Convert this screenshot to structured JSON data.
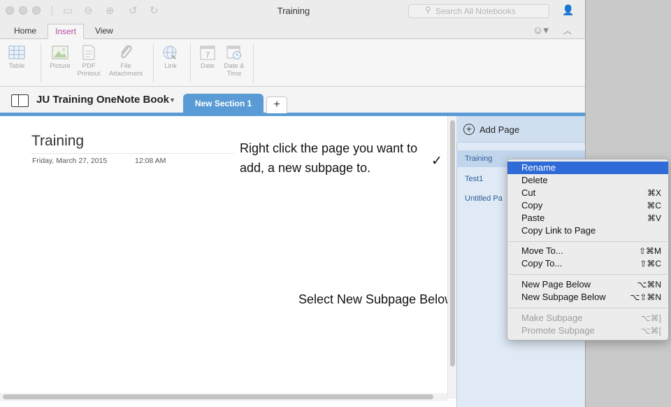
{
  "window": {
    "title": "Training"
  },
  "search": {
    "placeholder": "Search All Notebooks"
  },
  "ribbon_tabs": [
    {
      "label": "Home"
    },
    {
      "label": "Insert"
    },
    {
      "label": "View"
    }
  ],
  "ribbon": {
    "table": "Table",
    "picture": "Picture",
    "pdf": [
      "PDF",
      "Printout"
    ],
    "file": [
      "File",
      "Attachment"
    ],
    "link": "Link",
    "date": "Date",
    "datetime": [
      "Date &",
      "Time"
    ],
    "date_icon_number": "7"
  },
  "notebook": {
    "name": "JU Training OneNote Book"
  },
  "sections": [
    {
      "label": "New Section 1"
    }
  ],
  "add_section": "+",
  "page": {
    "title": "Training",
    "date": "Friday, March 27, 2015",
    "time": "12:08 AM"
  },
  "annotations": {
    "text1": "Right click the page you want to add, a new subpage to.",
    "check": "✓",
    "text2": "Select New Subpage Below.",
    "arrow": "〉"
  },
  "pages_panel": {
    "add_page_label": "Add Page",
    "items": [
      "Training",
      "Test1",
      "Untitled Pa"
    ]
  },
  "context_menu": {
    "rename": {
      "label": "Rename"
    },
    "delete": {
      "label": "Delete"
    },
    "cut": {
      "label": "Cut",
      "shortcut": "⌘X"
    },
    "copy": {
      "label": "Copy",
      "shortcut": "⌘C"
    },
    "paste": {
      "label": "Paste",
      "shortcut": "⌘V"
    },
    "copy_link": {
      "label": "Copy Link to Page"
    },
    "move_to": {
      "label": "Move To...",
      "shortcut": "⇧⌘M"
    },
    "copy_to": {
      "label": "Copy To...",
      "shortcut": "⇧⌘C"
    },
    "new_page_below": {
      "label": "New Page Below",
      "shortcut": "⌥⌘N"
    },
    "new_subpage_below": {
      "label": "New Subpage Below",
      "shortcut": "⌥⇧⌘N"
    },
    "make_subpage": {
      "label": "Make Subpage",
      "shortcut": "⌥⌘]"
    },
    "promote_subpage": {
      "label": "Promote Subpage",
      "shortcut": "⌥⌘["
    }
  },
  "colors": {
    "accent": "#5b9bd5",
    "menu_highlight": "#2f6bd6",
    "insert_tab": "#b54a9e"
  }
}
